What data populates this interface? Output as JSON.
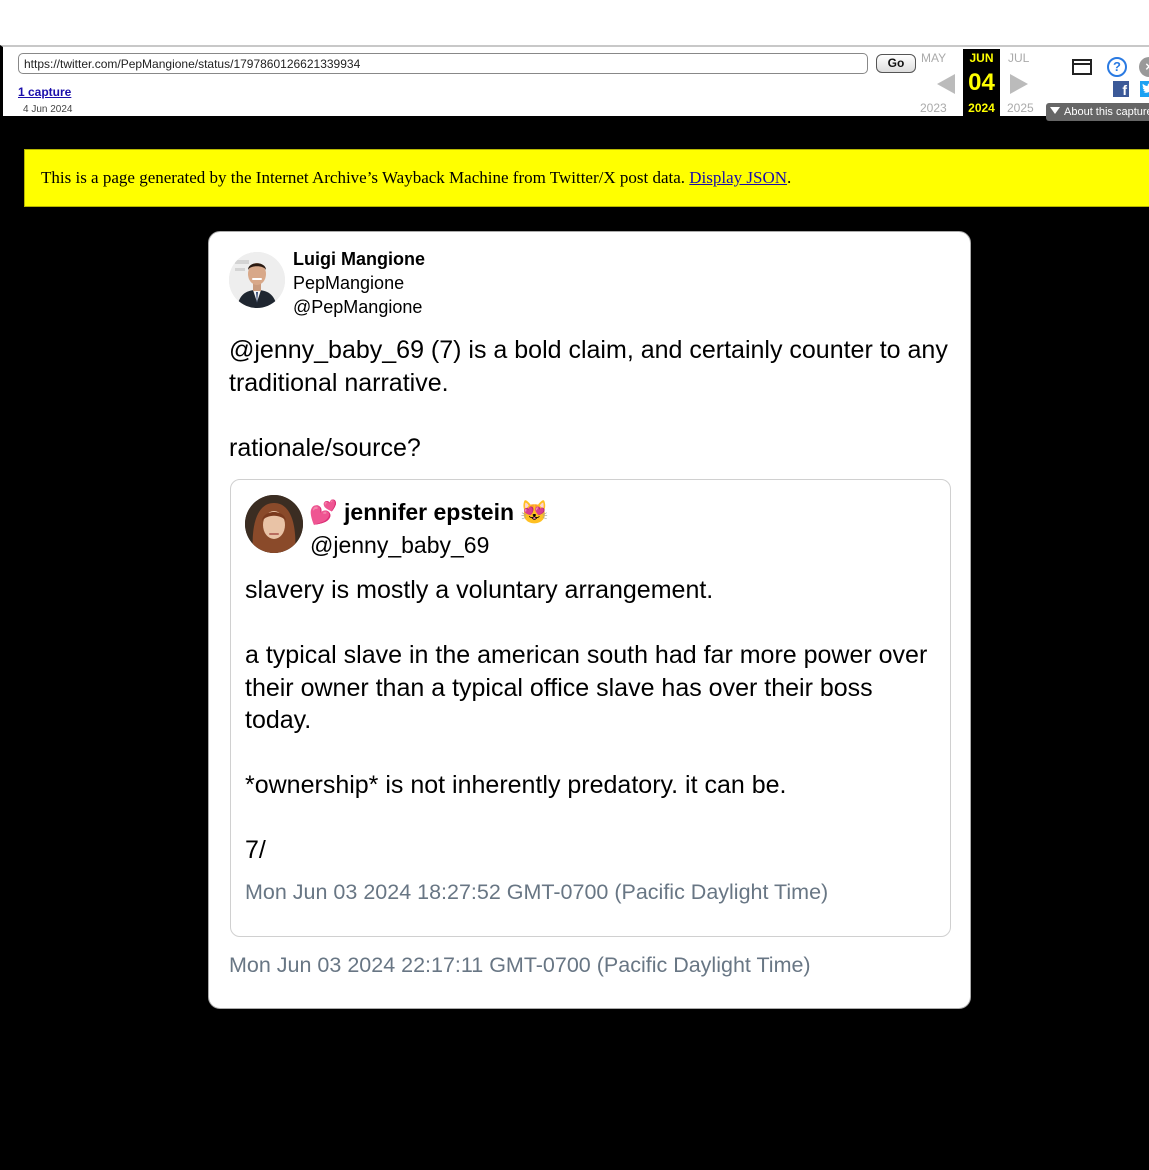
{
  "wayback": {
    "url": "https://twitter.com/PepMangione/status/1797860126621339934",
    "go_label": "Go",
    "captures_label": "1 capture",
    "capture_date": "4 Jun 2024",
    "prev_month": "MAY",
    "current_month": "JUN",
    "next_month": "JUL",
    "current_day": "04",
    "prev_year": "2023",
    "current_year": "2024",
    "next_year": "2025",
    "about_label": "About this capture",
    "help_glyph": "?",
    "close_glyph": "×",
    "facebook_glyph": "f",
    "icons": [
      "window-icon",
      "help-icon",
      "close-icon",
      "facebook-icon",
      "twitter-icon"
    ]
  },
  "notice": {
    "text": "This is a page generated by the Internet Archive’s Wayback Machine from Twitter/X post data.",
    "link": "Display JSON",
    "suffix": ".",
    "background": "#ffff00"
  },
  "tweet": {
    "name": "Luigi Mangione",
    "display": "PepMangione",
    "handle": "@PepMangione",
    "text": "@jenny_baby_69 (7) is a bold claim, and certainly counter to any traditional narrative.\n\nrationale/source?",
    "timestamp": "Mon Jun 03 2024 22:17:11 GMT-0700 (Pacific Daylight Time)",
    "quoted": {
      "name": "💕 jennifer epstein 😻",
      "handle": "@jenny_baby_69",
      "text": "slavery is mostly a voluntary arrangement.\n\na typical slave in the american south had far more power over their owner than a typical office slave has over their boss today.\n\n*ownership* is not inherently predatory. it can be.\n\n7/",
      "timestamp": "Mon Jun 03 2024 18:27:52 GMT-0700 (Pacific Daylight Time)"
    }
  },
  "colors": {
    "timestamp": "#687684",
    "wayback_highlight": "#ffff00",
    "page_background": "#000000"
  }
}
